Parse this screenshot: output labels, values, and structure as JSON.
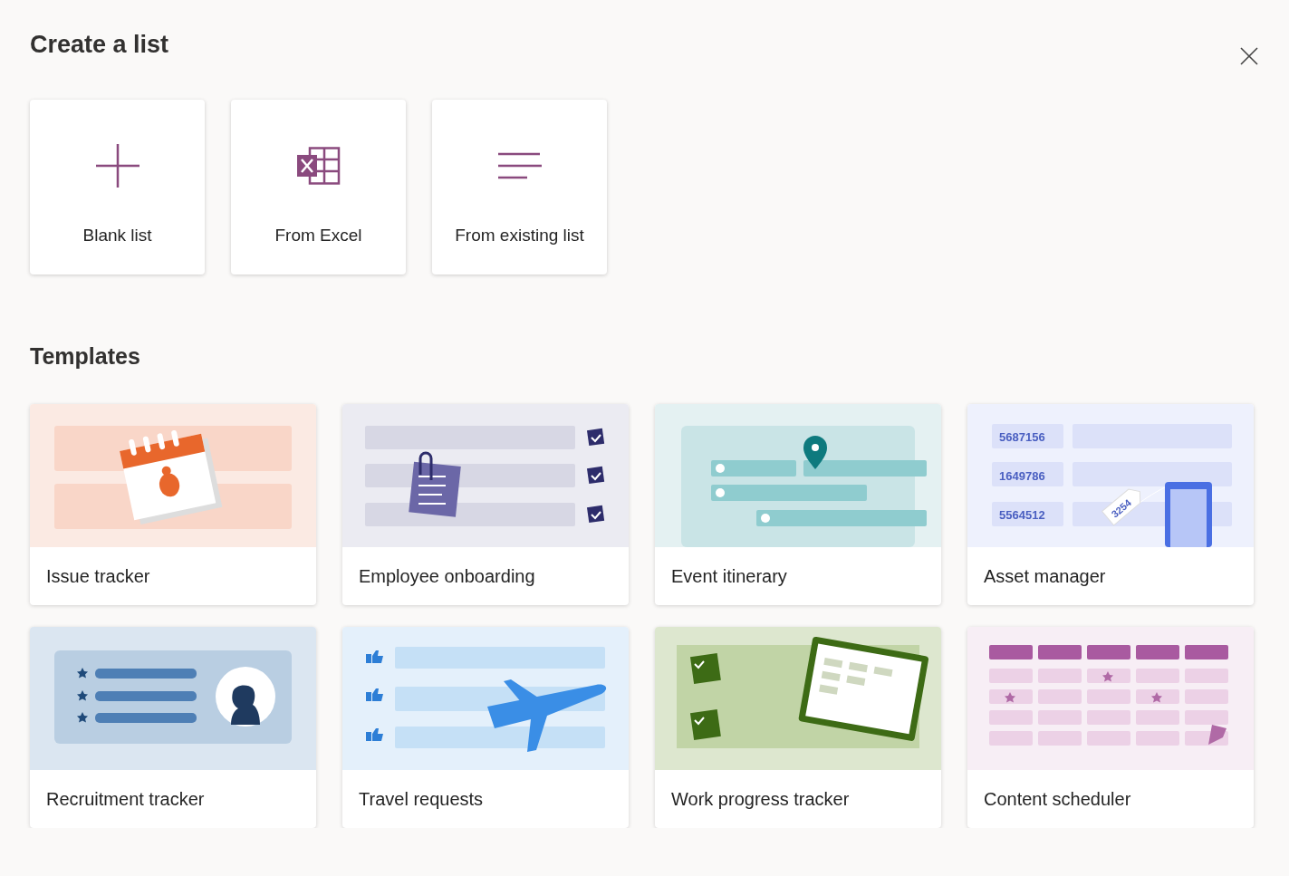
{
  "title": "Create a list",
  "create_options": [
    {
      "kind": "blank",
      "label": "Blank list"
    },
    {
      "kind": "excel",
      "label": "From Excel"
    },
    {
      "kind": "existing",
      "label": "From existing list"
    }
  ],
  "templates_heading": "Templates",
  "templates": [
    {
      "kind": "issue",
      "label": "Issue tracker"
    },
    {
      "kind": "onboarding",
      "label": "Employee onboarding"
    },
    {
      "kind": "itinerary",
      "label": "Event itinerary"
    },
    {
      "kind": "asset",
      "label": "Asset manager",
      "image_texts": [
        "5687156",
        "1649786",
        "5564512",
        "3254"
      ]
    },
    {
      "kind": "recruitment",
      "label": "Recruitment tracker"
    },
    {
      "kind": "travel",
      "label": "Travel requests"
    },
    {
      "kind": "progress",
      "label": "Work progress tracker"
    },
    {
      "kind": "scheduler",
      "label": "Content scheduler"
    }
  ]
}
